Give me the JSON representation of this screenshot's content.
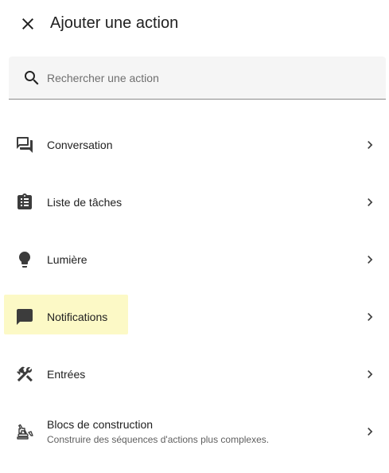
{
  "dialog": {
    "title": "Ajouter une action",
    "close_icon": "close-icon"
  },
  "search": {
    "placeholder": "Rechercher une action",
    "value": "",
    "icon": "search-icon"
  },
  "items": [
    {
      "label": "Conversation",
      "sublabel": "",
      "icon": "conversation-icon"
    },
    {
      "label": "Liste de tâches",
      "sublabel": "",
      "icon": "clipboard-list-icon"
    },
    {
      "label": "Lumière",
      "sublabel": "",
      "icon": "lightbulb-icon"
    },
    {
      "label": "Notifications",
      "sublabel": "",
      "icon": "message-icon",
      "highlighted": true
    },
    {
      "label": "Entrées",
      "sublabel": "",
      "icon": "tools-icon"
    },
    {
      "label": "Blocs de construction",
      "sublabel": "Construire des séquences d'actions plus complexes.",
      "icon": "excavator-icon"
    }
  ],
  "colors": {
    "highlight": "#fcf9c6",
    "icon": "#3c3c3c",
    "search_bg": "#f5f5f5"
  }
}
